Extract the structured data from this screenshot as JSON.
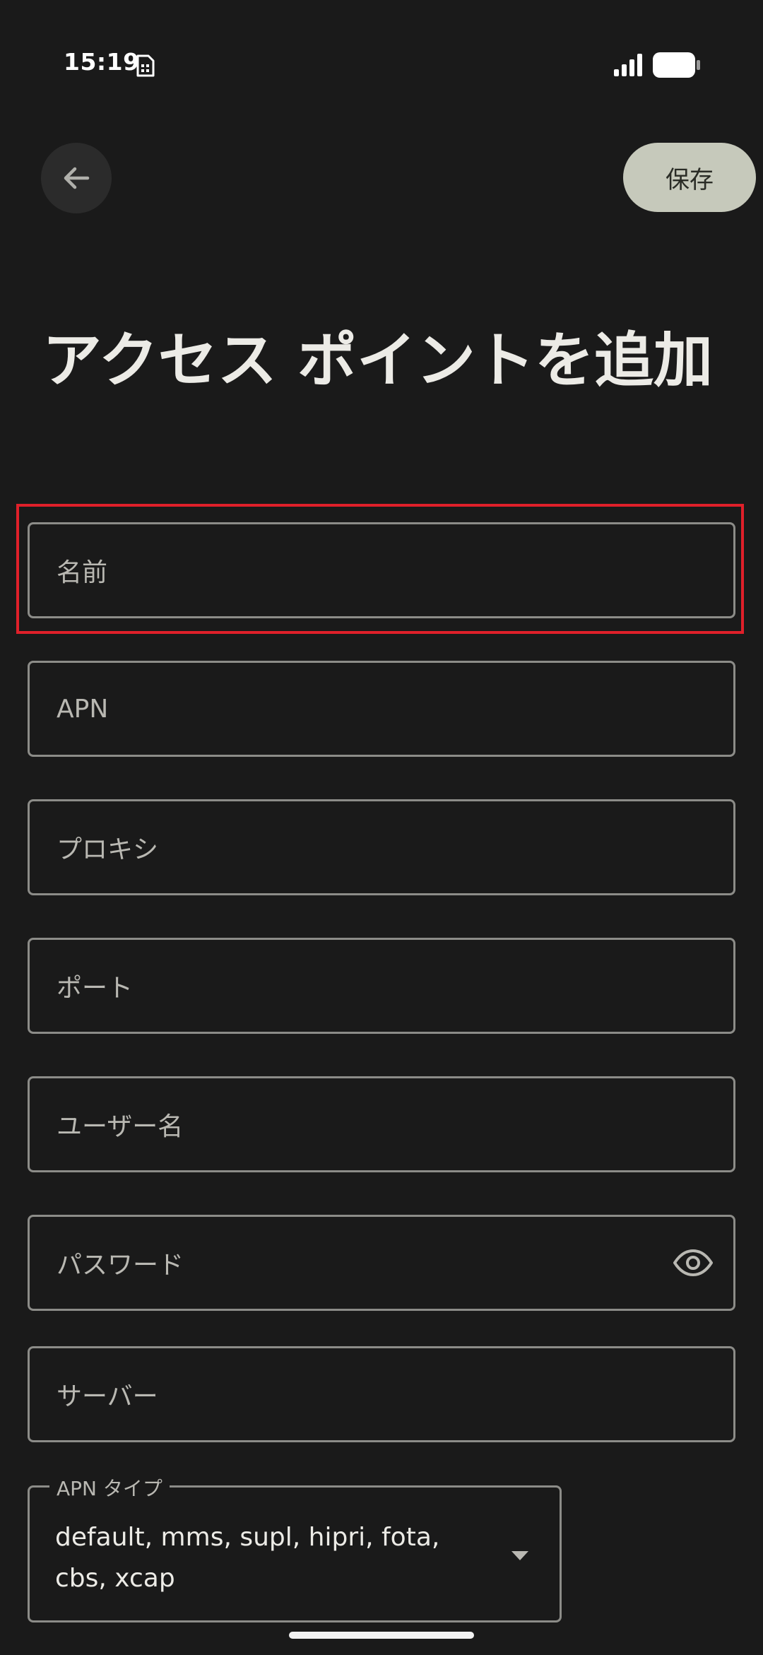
{
  "status_bar": {
    "time": "15:19",
    "icons": [
      "sim-card-icon",
      "signal-icon",
      "battery-icon"
    ]
  },
  "toolbar": {
    "back_icon": "arrow-left-icon",
    "save_label": "保存"
  },
  "page": {
    "title": "アクセス ポイントを追加"
  },
  "fields": {
    "name": {
      "placeholder": "名前",
      "value": ""
    },
    "apn": {
      "placeholder": "APN",
      "value": ""
    },
    "proxy": {
      "placeholder": "プロキシ",
      "value": ""
    },
    "port": {
      "placeholder": "ポート",
      "value": ""
    },
    "username": {
      "placeholder": "ユーザー名",
      "value": ""
    },
    "password": {
      "placeholder": "パスワード",
      "value": "",
      "toggle_icon": "eye-icon"
    },
    "server": {
      "placeholder": "サーバー",
      "value": ""
    },
    "apn_type": {
      "label": "APN タイプ",
      "value": "default, mms, supl, hipri, fota, cbs, xcap",
      "icon": "dropdown-arrow-icon"
    }
  },
  "colors": {
    "background": "#1a1a1a",
    "save_button_bg": "#c6c9bb",
    "field_border": "#8c8c88",
    "highlight": "#e0202a"
  }
}
